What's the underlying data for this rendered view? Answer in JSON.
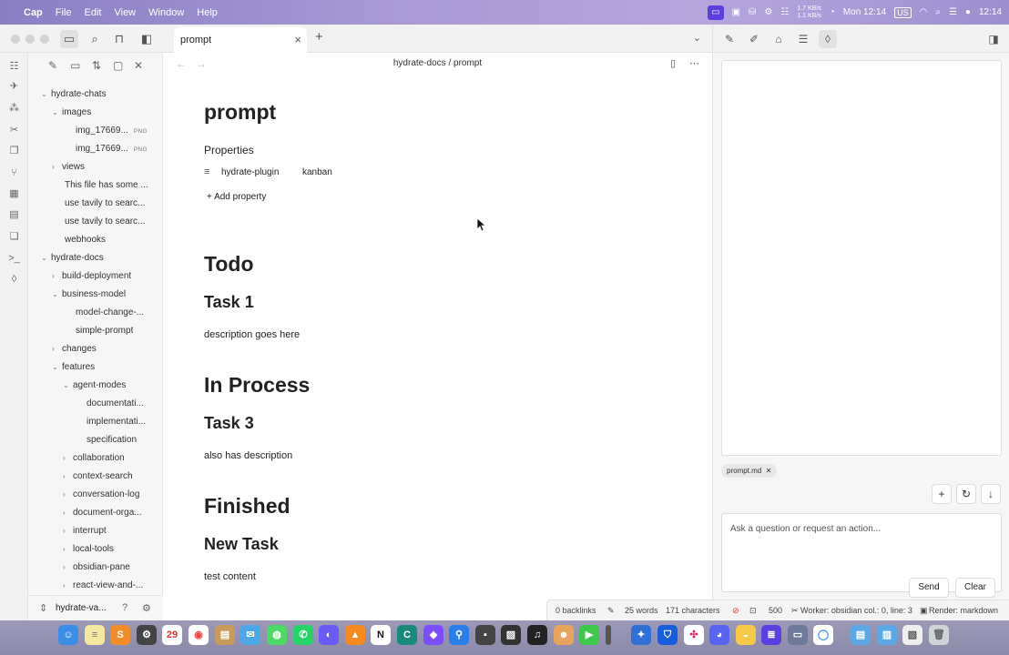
{
  "menubar": {
    "app": "Cap",
    "menus": [
      "File",
      "Edit",
      "View",
      "Window",
      "Help"
    ],
    "net_up": "1.7 KB/s",
    "net_down": "1.1 KB/s",
    "datetime": "Mon 12:14",
    "input_source": "US",
    "clock": "12:14"
  },
  "tab": {
    "label": "prompt"
  },
  "breadcrumb": "hydrate-docs / prompt",
  "tree": [
    {
      "label": "hydrate-chats",
      "chev": "⌄"
    },
    {
      "label": "images",
      "chev": "⌄"
    },
    {
      "label": "img_17669...",
      "ext": "PNG"
    },
    {
      "label": "img_17669...",
      "ext": "PNG"
    },
    {
      "label": "views",
      "chev": "›"
    },
    {
      "label": "This file has some ..."
    },
    {
      "label": "use tavily to searc..."
    },
    {
      "label": "use tavily to searc..."
    },
    {
      "label": "webhooks"
    },
    {
      "label": "hydrate-docs",
      "chev": "⌄"
    },
    {
      "label": "build-deployment",
      "chev": "›"
    },
    {
      "label": "business-model",
      "chev": "⌄"
    },
    {
      "label": "model-change-..."
    },
    {
      "label": "simple-prompt"
    },
    {
      "label": "changes",
      "chev": "›"
    },
    {
      "label": "features",
      "chev": "⌄"
    },
    {
      "label": "agent-modes",
      "chev": "⌄"
    },
    {
      "label": "documentati..."
    },
    {
      "label": "implementati..."
    },
    {
      "label": "specification"
    },
    {
      "label": "collaboration",
      "chev": "›"
    },
    {
      "label": "context-search",
      "chev": "›"
    },
    {
      "label": "conversation-log",
      "chev": "›"
    },
    {
      "label": "document-orga...",
      "chev": "›"
    },
    {
      "label": "interrupt",
      "chev": "›"
    },
    {
      "label": "local-tools",
      "chev": "›"
    },
    {
      "label": "obsidian-pane",
      "chev": "›"
    },
    {
      "label": "react-view-and-...",
      "chev": "›"
    }
  ],
  "vault": {
    "name": "hydrate-va..."
  },
  "doc": {
    "title": "prompt",
    "properties_label": "Properties",
    "property_key": "hydrate-plugin",
    "property_value": "kanban",
    "add_property": "Add property",
    "sections": [
      {
        "heading": "Todo",
        "task": "Task 1",
        "body": "description goes here"
      },
      {
        "heading": "In Process",
        "task": "Task 3",
        "body": "also has description"
      },
      {
        "heading": "Finished",
        "task": "New Task",
        "body": "test content"
      }
    ]
  },
  "status": {
    "backlinks": "0 backlinks",
    "words": "25 words",
    "chars": "171 characters",
    "num": "500",
    "worker": "Worker: obsidian col.: 0, line: 3",
    "render": "Render: markdown"
  },
  "chat": {
    "file_chip": "prompt.md",
    "placeholder": "Ask a question or request an action...",
    "send": "Send",
    "clear": "Clear"
  },
  "dock": {
    "calendar_day": "29"
  }
}
